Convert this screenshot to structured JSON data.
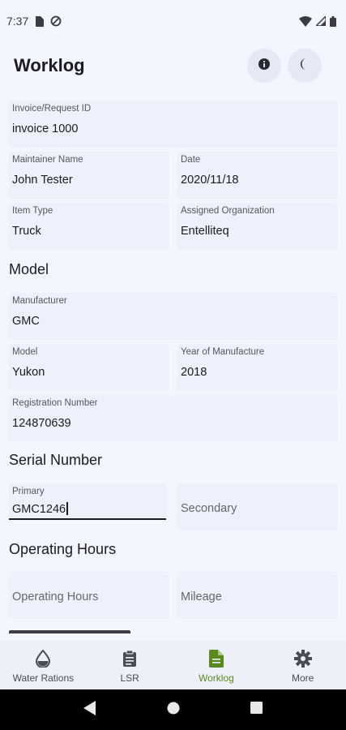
{
  "status": {
    "time": "7:37"
  },
  "app": {
    "title": "Worklog"
  },
  "fields": {
    "invoice": {
      "label": "Invoice/Request ID",
      "value": "invoice 1000"
    },
    "maintainer": {
      "label": "Maintainer Name",
      "value": "John Tester"
    },
    "date": {
      "label": "Date",
      "value": "2020/11/18"
    },
    "item_type": {
      "label": "Item Type",
      "value": "Truck"
    },
    "organization": {
      "label": "Assigned Organization",
      "value": "Entelliteq"
    },
    "manufacturer": {
      "label": "Manufacturer",
      "value": "GMC"
    },
    "model": {
      "label": "Model",
      "value": "Yukon"
    },
    "year": {
      "label": "Year of Manufacture",
      "value": "2018"
    },
    "registration": {
      "label": "Registration Number",
      "value": "124870639"
    },
    "serial_primary": {
      "label": "Primary",
      "value": "GMC1246"
    },
    "serial_secondary": {
      "placeholder": "Secondary"
    },
    "operating_hours": {
      "placeholder": "Operating Hours"
    },
    "mileage": {
      "placeholder": "Mileage"
    }
  },
  "sections": {
    "model": "Model",
    "serial": "Serial Number",
    "hours": "Operating Hours"
  },
  "nav": {
    "items": [
      {
        "label": "Water Rations",
        "icon": "water-drop-icon"
      },
      {
        "label": "LSR",
        "icon": "clipboard-icon"
      },
      {
        "label": "Worklog",
        "icon": "document-icon",
        "active": true
      },
      {
        "label": "More",
        "icon": "gear-icon"
      }
    ]
  },
  "colors": {
    "accent": "#5a8a1e",
    "background": "#f3f5ff",
    "field": "#eef0fb"
  }
}
